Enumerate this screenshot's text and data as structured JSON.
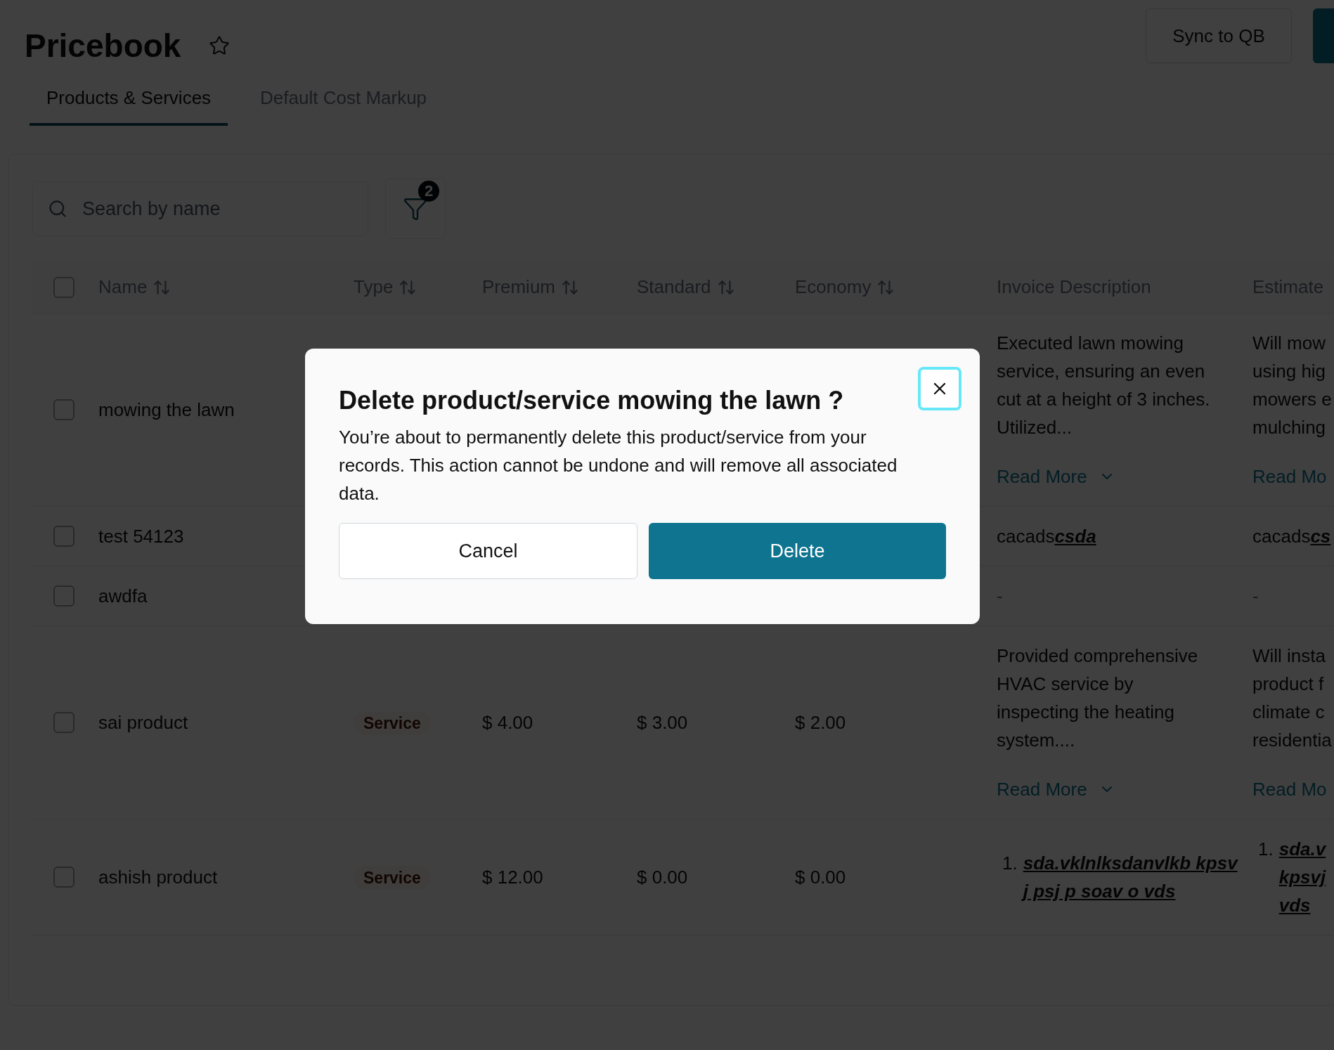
{
  "page": {
    "title": "Pricebook",
    "sync_button": "Sync to QB"
  },
  "tabs": [
    {
      "label": "Products & Services",
      "selected": true
    },
    {
      "label": "Default Cost Markup",
      "selected": false
    }
  ],
  "search": {
    "placeholder": "Search by name"
  },
  "filter": {
    "badge": "2"
  },
  "table": {
    "all_selected": false,
    "columns": [
      {
        "label": "Name",
        "sortable": true
      },
      {
        "label": "Type",
        "sortable": true
      },
      {
        "label": "Premium",
        "sortable": true
      },
      {
        "label": "Standard",
        "sortable": true
      },
      {
        "label": "Economy",
        "sortable": true
      },
      {
        "label": "Invoice Description",
        "sortable": false
      },
      {
        "label": "Estimate",
        "sortable": false
      }
    ],
    "rows": [
      {
        "selected": false,
        "name": "mowing the lawn",
        "invoice": {
          "kind": "paragraph",
          "text": "Executed lawn mowing service, ensuring an even cut at a height of 3 inches. Utilized...",
          "read_more": "Read More"
        },
        "estimate": {
          "kind": "paragraph",
          "lines": [
            "Will mow",
            "using hig",
            "mowers e",
            "mulching"
          ],
          "read_more": "Read Mo"
        }
      },
      {
        "selected": false,
        "name": "test 54123",
        "invoice": {
          "kind": "link",
          "text": "cacads",
          "link": "csda"
        },
        "estimate": {
          "kind": "link",
          "text": "cacads",
          "link": "cs"
        }
      },
      {
        "selected": false,
        "name": "awdfa",
        "invoice": {
          "kind": "dash",
          "text": "-"
        },
        "estimate": {
          "kind": "dash",
          "text": "-"
        }
      },
      {
        "selected": false,
        "name": "sai product",
        "type": "Service",
        "premium": "$ 4.00",
        "standard": "$ 3.00",
        "economy": "$ 2.00",
        "invoice": {
          "kind": "paragraph",
          "text": "Provided comprehensive HVAC service by inspecting the heating system....",
          "read_more": "Read More"
        },
        "estimate": {
          "kind": "paragraph",
          "lines": [
            "Will insta",
            "product f",
            "climate c",
            "residentia"
          ],
          "read_more": "Read Mo"
        }
      },
      {
        "selected": false,
        "name": "ashish product",
        "type": "Service",
        "premium": "$ 12.00",
        "standard": "$ 0.00",
        "economy": "$ 0.00",
        "invoice": {
          "kind": "list",
          "items": [
            {
              "marker": "1.",
              "text": "sda.vklnlksdanvlkb kpsvj psj p soav o vds"
            }
          ]
        },
        "estimate": {
          "kind": "list",
          "items": [
            {
              "marker": "1.",
              "lines": [
                "sda.v",
                "kpsvj",
                "vds"
              ]
            }
          ]
        }
      }
    ]
  },
  "dialog": {
    "title": "Delete product/service mowing the lawn ?",
    "body": "You’re about to permanently delete this product/service from your records. This action cannot be undone and will remove all associated data.",
    "cancel": "Cancel",
    "confirm": "Delete"
  }
}
